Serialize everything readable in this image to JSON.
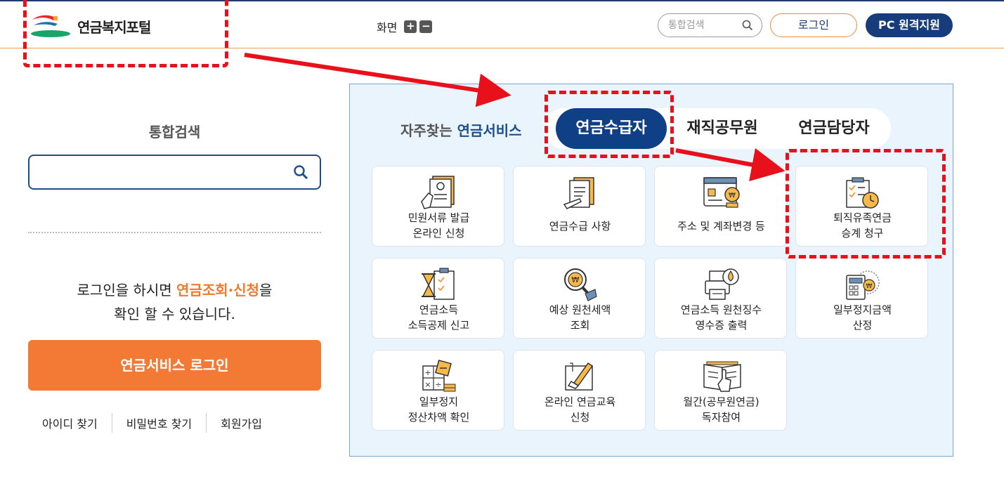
{
  "header": {
    "logo_text": "연금복지포털",
    "zoom_label": "화면",
    "zoom_in": "+",
    "zoom_out": "−",
    "search_placeholder": "통합검색",
    "login": "로그인",
    "remote_support": "PC 원격지원"
  },
  "left": {
    "search_title": "통합검색",
    "search_value": "",
    "login_msg_prefix": "로그인을 하시면 ",
    "login_msg_highlight": "연금조회·신청",
    "login_msg_suffix": "을",
    "login_msg_line2": "확인 할 수 있습니다.",
    "service_login": "연금서비스 로그인",
    "links": [
      "아이디 찾기",
      "비밀번호 찾기",
      "회원가입"
    ]
  },
  "panel": {
    "freq_prefix": "자주찾는 ",
    "freq_highlight": "연금서비스",
    "tabs": [
      "연금수급자",
      "재직공무원",
      "연금담당자"
    ],
    "active_tab": "연금수급자",
    "cards": [
      {
        "line1": "민원서류 발급",
        "line2": "온라인 신청",
        "icon": "document-hand-icon"
      },
      {
        "line1": "연금수급 사항",
        "line2": "",
        "icon": "document-pen-icon"
      },
      {
        "line1": "주소 및 계좌변경 등",
        "line2": "",
        "icon": "card-coin-icon"
      },
      {
        "line1": "퇴직유족연금",
        "line2": "승계 청구",
        "icon": "checklist-clock-icon"
      },
      {
        "line1": "연금소득",
        "line2": "소득공제 신고",
        "icon": "hourglass-clipboard-icon"
      },
      {
        "line1": "예상 원천세액",
        "line2": "조회",
        "icon": "magnifier-coin-icon"
      },
      {
        "line1": "연금소득 원천징수",
        "line2": "영수증 출력",
        "icon": "printer-drop-icon"
      },
      {
        "line1": "일부정지금액",
        "line2": "산정",
        "icon": "calculator-coin-icon"
      },
      {
        "line1": "일부정지",
        "line2": "정산차액 확인",
        "icon": "math-calculator-icon"
      },
      {
        "line1": "온라인 연금교육",
        "line2": "신청",
        "icon": "pen-document-icon"
      },
      {
        "line1": "월간(공무원연금)",
        "line2": "독자참여",
        "icon": "book-hand-icon"
      }
    ]
  },
  "colors": {
    "navy": "#173c7c",
    "orange": "#f27a34",
    "annotation_red": "#e8101b",
    "panel_bg": "#eaf4fc"
  }
}
